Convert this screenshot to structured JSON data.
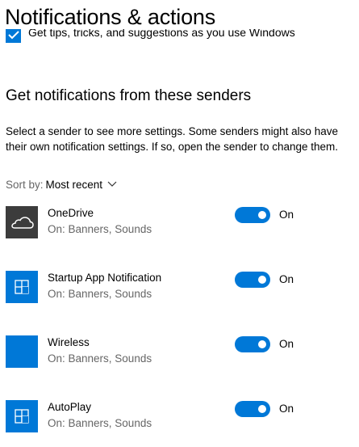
{
  "page": {
    "title": "Notifications & actions"
  },
  "tips": {
    "label": "Get tips, tricks, and suggestions as you use Windows",
    "checked": true
  },
  "senders_section": {
    "title": "Get notifications from these senders",
    "description": "Select a sender to see more settings. Some senders might also have their own notification settings. If so, open the sender to change them.",
    "sort_label": "Sort by:",
    "sort_value": "Most recent"
  },
  "senders": [
    {
      "name": "OneDrive",
      "status": "On: Banners, Sounds",
      "toggle_label": "On",
      "enabled": true,
      "icon": "onedrive-cloud-icon"
    },
    {
      "name": "Startup App Notification",
      "status": "On: Banners, Sounds",
      "toggle_label": "On",
      "enabled": true,
      "icon": "app-tile-icon"
    },
    {
      "name": "Wireless",
      "status": "On: Banners, Sounds",
      "toggle_label": "On",
      "enabled": true,
      "icon": "blank-tile-icon"
    },
    {
      "name": "AutoPlay",
      "status": "On: Banners, Sounds",
      "toggle_label": "On",
      "enabled": true,
      "icon": "app-tile-icon"
    }
  ],
  "colors": {
    "accent": "#0078d7",
    "secondary_text": "#666666",
    "onedrive_tile": "#3c3c3c"
  }
}
